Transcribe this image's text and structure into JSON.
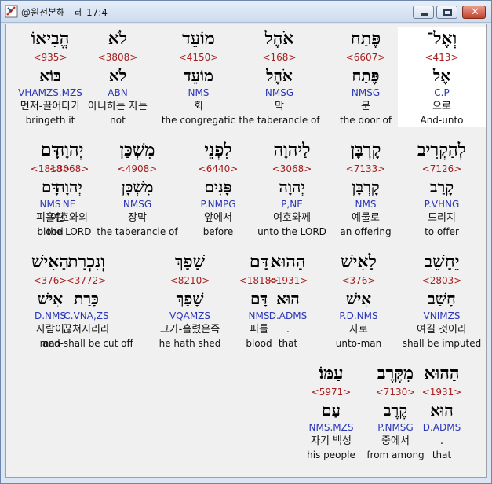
{
  "window": {
    "title": "@원전본해 - 레 17:4",
    "app_icon": "bible-app-icon",
    "buttons": [
      "minimize-icon",
      "maximize-icon",
      "close-icon"
    ]
  },
  "colors": {
    "strong_number": "#a81e1e",
    "morphology": "#2a35b8",
    "selected_background": "#ffffff"
  },
  "words": [
    {
      "heb": "וְאֶל־",
      "strong": "<413>",
      "lex": "אֶל",
      "morph": "C.P",
      "kor": "으로",
      "eng": "And-unto",
      "selected": true
    },
    {
      "heb": "פֶּתַח",
      "strong": "<6607>",
      "lex": "פֶּתַח",
      "morph": "NMSG",
      "kor": "문",
      "eng": "the door of"
    },
    {
      "heb": "אֹהֶל",
      "strong": "<168>",
      "lex": "אֹהֶל",
      "morph": "NMSG",
      "kor": "막",
      "eng": "the taberancle of"
    },
    {
      "heb": "מוֹעֵד",
      "strong": "<4150>",
      "lex": "מוֹעֵד",
      "morph": "NMS",
      "kor": "회",
      "eng": "the congregatic"
    },
    {
      "heb": "לֹא",
      "strong": "<3808>",
      "lex": "לֹא",
      "morph": "ABN",
      "kor": "아니하는 자는",
      "eng": "not"
    },
    {
      "heb": "הֱבִיאוֹ",
      "strong": "<935>",
      "lex": "בּוֹא",
      "morph": "VHAMZS.MZS",
      "kor": "먼저-끌어다가",
      "eng": "bringeth it"
    },
    {
      "heb": "לְהַקְרִיב",
      "strong": "<7126>",
      "lex": "קָרַב",
      "morph": "P.VHNG",
      "kor": "드리지",
      "eng": "to offer"
    },
    {
      "heb": "קָרְבָּן",
      "strong": "<7133>",
      "lex": "קָרְבָּן",
      "morph": "NMS",
      "kor": "예물로",
      "eng": "an offering"
    },
    {
      "heb": "לַיהוָה",
      "strong": "<3068>",
      "lex": "יְהוָה",
      "morph": "P,NE",
      "kor": "여호와께",
      "eng": "unto the LORD"
    },
    {
      "heb": "לִפְנֵי",
      "strong": "<6440>",
      "lex": "פָּנִים",
      "morph": "P.NMPG",
      "kor": "앞에서",
      "eng": "before"
    },
    {
      "heb": "מִשְׁכַּן",
      "strong": "<4908>",
      "lex": "מִשְׁכָּן",
      "morph": "NMSG",
      "kor": "장막",
      "eng": "the taberancle of"
    },
    {
      "heb": "יְהוָה",
      "strong": "<3068>",
      "lex": "יְהוָה",
      "morph": "NE",
      "kor": "여호와의",
      "eng": "the LORD"
    },
    {
      "heb": "דָּם",
      "strong": "<1818>",
      "lex": "דָּם",
      "morph": "NMS",
      "kor": "피흘린",
      "eng": "blood"
    },
    {
      "heb": "יֵחָשֵׁב",
      "strong": "<2803>",
      "lex": "חָשַׁב",
      "morph": "VNIMZS",
      "kor": "여길 것이라",
      "eng": "shall be imputed"
    },
    {
      "heb": "לָאִישׁ",
      "strong": "<376>",
      "lex": "אִישׁ",
      "morph": "P.D.NMS",
      "kor": "자로",
      "eng": "unto-man"
    },
    {
      "heb": "הַהוּא",
      "strong": "<1931>",
      "lex": "הוּא",
      "morph": "D.ADMS",
      "kor": ".",
      "eng": "that"
    },
    {
      "heb": "דָּם",
      "strong": "<1818>",
      "lex": "דָּם",
      "morph": "NMS",
      "kor": "피를",
      "eng": "blood"
    },
    {
      "heb": "שָׁפָךְ",
      "strong": "<8210>",
      "lex": "שָׁפַךְ",
      "morph": "VQAMZS",
      "kor": "그가-흘렸은즉",
      "eng": "he hath shed"
    },
    {
      "heb": "וְנִכְרַת",
      "strong": "<3772>",
      "lex": "כָּרַת",
      "morph": "C.VNA,ZS",
      "kor": "끊쳐지리라",
      "eng": "and-shall be cut off"
    },
    {
      "heb": "הָאִישׁ",
      "strong": "<376>",
      "lex": "אִישׁ",
      "morph": "D.NMS",
      "kor": "사람이",
      "eng": "man"
    },
    {
      "heb": "הַהוּא",
      "strong": "<1931>",
      "lex": "הוּא",
      "morph": "D.ADMS",
      "kor": ".",
      "eng": "that"
    },
    {
      "heb": "מִקֶּרֶב",
      "strong": "<7130>",
      "lex": "קֶרֶב",
      "morph": "P.NMSG",
      "kor": "중에서",
      "eng": "from among"
    },
    {
      "heb": "עַמּוֹ׃",
      "strong": "<5971>",
      "lex": "עַם",
      "morph": "NMS.MZS",
      "kor": "자기 백성",
      "eng": "his people"
    }
  ]
}
